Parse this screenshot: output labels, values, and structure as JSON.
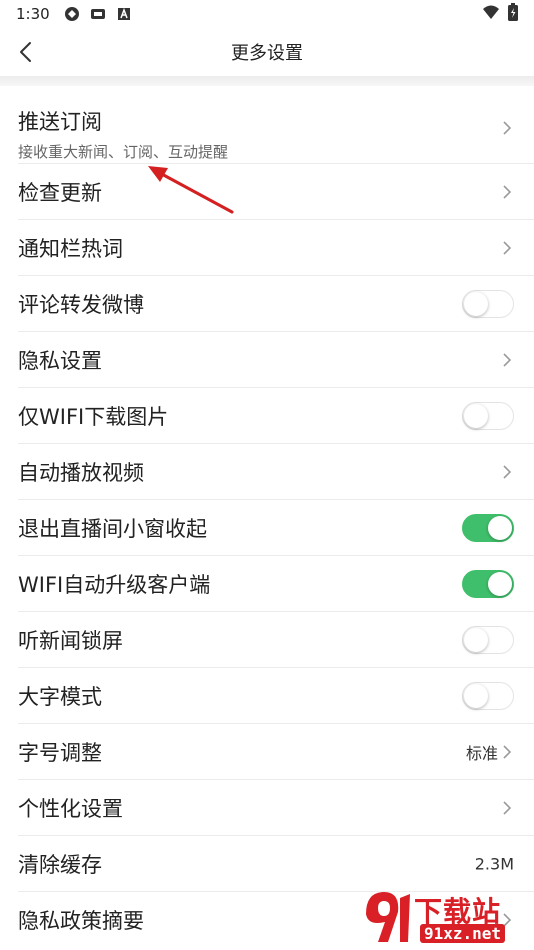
{
  "status_bar": {
    "time": "1:30",
    "icons": [
      "sync-icon",
      "app-notification-icon",
      "a-icon"
    ],
    "right_icons": [
      "wifi-icon",
      "battery-charging-icon"
    ]
  },
  "nav": {
    "title": "更多设置",
    "back_icon": "back-chevron-icon"
  },
  "settings": [
    {
      "label": "推送订阅",
      "sub": "接收重大新闻、订阅、互动提醒",
      "control": "chevron"
    },
    {
      "label": "检查更新",
      "control": "chevron"
    },
    {
      "label": "通知栏热词",
      "control": "chevron"
    },
    {
      "label": "评论转发微博",
      "control": "toggle",
      "on": false
    },
    {
      "label": "隐私设置",
      "control": "chevron"
    },
    {
      "label": "仅WIFI下载图片",
      "control": "toggle",
      "on": false
    },
    {
      "label": "自动播放视频",
      "control": "chevron"
    },
    {
      "label": "退出直播间小窗收起",
      "control": "toggle",
      "on": true
    },
    {
      "label": "WIFI自动升级客户端",
      "control": "toggle",
      "on": true
    },
    {
      "label": "听新闻锁屏",
      "control": "toggle",
      "on": false
    },
    {
      "label": "大字模式",
      "control": "toggle",
      "on": false
    },
    {
      "label": "字号调整",
      "control": "chevron",
      "value": "标准"
    },
    {
      "label": "个性化设置",
      "control": "chevron"
    },
    {
      "label": "清除缓存",
      "control": "value",
      "value": "2.3M"
    },
    {
      "label": "隐私政策摘要",
      "control": "chevron"
    }
  ],
  "watermark": {
    "brand": "下载站",
    "url": "91xz.net"
  },
  "colors": {
    "toggle_on": "#3fbf6b",
    "annotation_arrow": "#d42020",
    "watermark": "#d92027"
  }
}
